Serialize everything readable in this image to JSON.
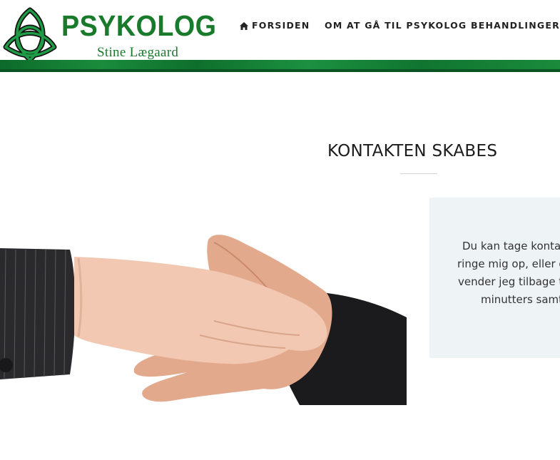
{
  "logo": {
    "title": "PSYKOLOG",
    "subtitle": "Stine Lægaard",
    "icon": "celtic-knot-icon"
  },
  "nav": {
    "items": [
      {
        "label": "FORSIDEN",
        "icon": "home-icon"
      },
      {
        "label": "OM AT GÅ TIL PSYKOLOG"
      },
      {
        "label": "BEHANDLINGER",
        "icon": "caret-down-icon"
      }
    ]
  },
  "colors": {
    "brand_green": "#1a7a2c",
    "band_green": "#148236",
    "box_bg": "#eef3f5"
  },
  "main": {
    "heading": "KONTAKTEN SKABES",
    "info_lines": [
      "Du kan tage kontakt",
      "ringe mig op, eller du",
      "vender jeg tilbage til",
      "minutters samta"
    ]
  }
}
